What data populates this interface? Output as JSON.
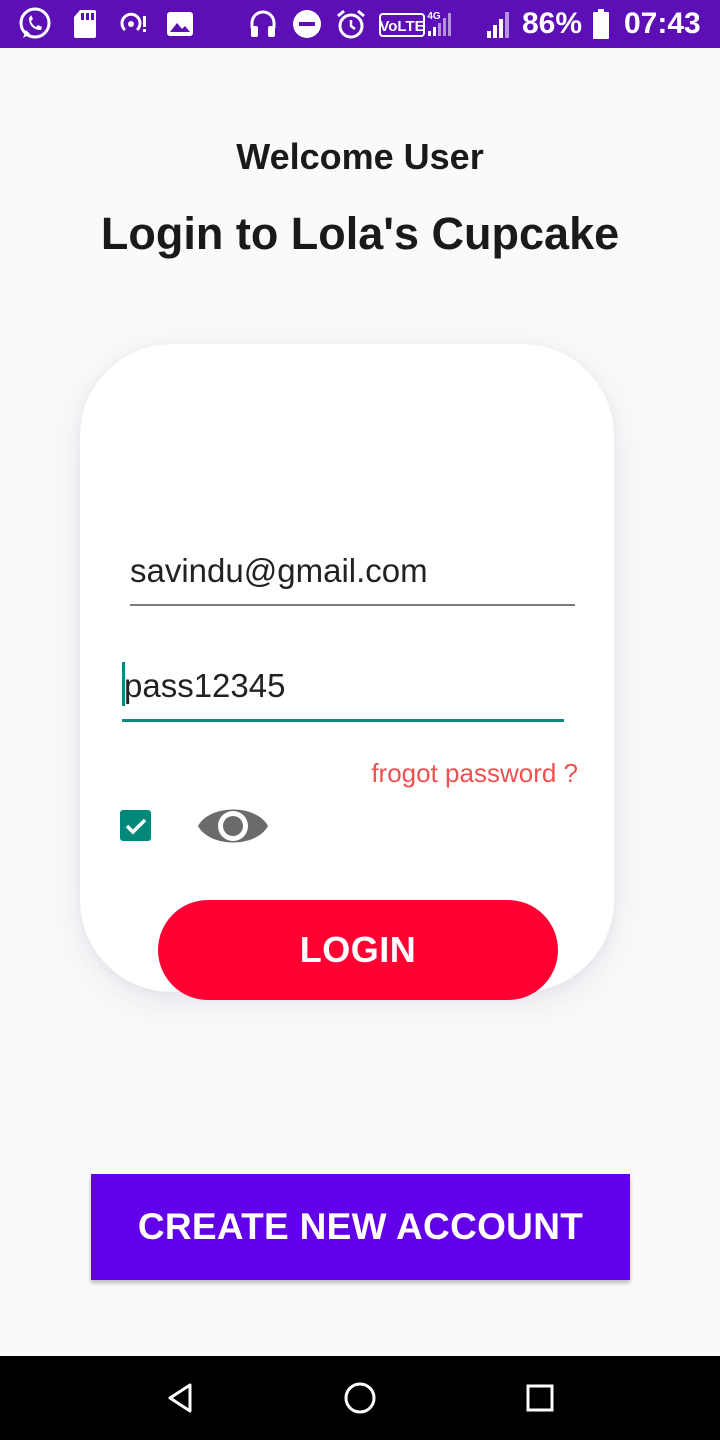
{
  "status_bar": {
    "battery": "86%",
    "time": "07:43",
    "network": "VoLTE",
    "network_gen": "4G",
    "icons": [
      "whatsapp-icon",
      "sd-card-icon",
      "hotspot-icon",
      "gallery-icon",
      "headphones-icon",
      "do-not-disturb-icon",
      "alarm-icon",
      "volte-icon",
      "signal-icon",
      "signal-icon",
      "battery-icon"
    ]
  },
  "header": {
    "welcome": "Welcome User",
    "title": "Login to Lola's Cupcake"
  },
  "form": {
    "email_value": "savindu@gmail.com",
    "password_value": "pass12345",
    "forgot_label": "frogot password ?",
    "show_password_checked": true,
    "login_label": "LOGIN"
  },
  "create_account_label": "CREATE NEW ACCOUNT",
  "nav": [
    "back-icon",
    "home-icon",
    "recents-icon"
  ],
  "colors": {
    "status_bar": "#5b0fb5",
    "accent": "#00897b",
    "login_button": "#ff0033",
    "create_button": "#6200ea",
    "forgot_text": "#f05050"
  }
}
